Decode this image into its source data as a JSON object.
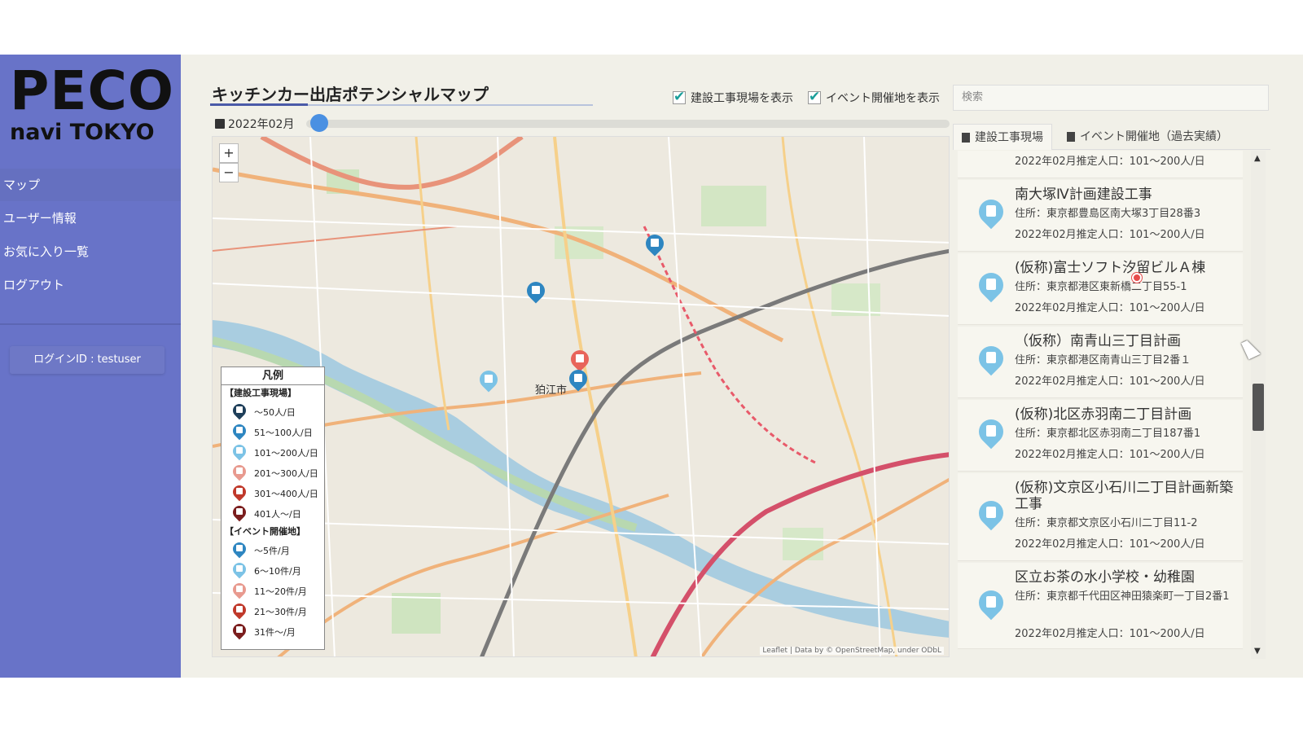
{
  "sidebar": {
    "logo_title": "PECO",
    "logo_sub": "navi TOKYO",
    "items": [
      {
        "label": "マップ"
      },
      {
        "label": "ユーザー情報"
      },
      {
        "label": "お気に入り一覧"
      },
      {
        "label": "ログアウト"
      }
    ],
    "login": "ログインID : testuser"
  },
  "header": {
    "title": "キッチンカー出店ポテンシャルマップ",
    "check_construction": "建設工事現場を表示",
    "check_event": "イベント開催地を表示",
    "search_placeholder": "検索"
  },
  "slider": {
    "date": "2022年02月"
  },
  "map": {
    "zoom_in": "+",
    "zoom_out": "−",
    "attribution": "Leaflet | Data by © OpenStreetMap, under ODbL",
    "town_label": "狛江市"
  },
  "legend": {
    "title": "凡例",
    "construction_heading": "【建設工事現場】",
    "construction": [
      {
        "label": "〜50人/日",
        "color": "#1f3f5a"
      },
      {
        "label": "51〜100人/日",
        "color": "#2e86c1"
      },
      {
        "label": "101〜200人/日",
        "color": "#7cc3e6"
      },
      {
        "label": "201〜300人/日",
        "color": "#e89a8f"
      },
      {
        "label": "301〜400人/日",
        "color": "#c0392b"
      },
      {
        "label": "401人〜/日",
        "color": "#7b1e1e"
      }
    ],
    "event_heading": "【イベント開催地】",
    "event": [
      {
        "label": "〜5件/月",
        "color": "#2e86c1"
      },
      {
        "label": "6〜10件/月",
        "color": "#7cc3e6"
      },
      {
        "label": "11〜20件/月",
        "color": "#e89a8f"
      },
      {
        "label": "21〜30件/月",
        "color": "#c0392b"
      },
      {
        "label": "31件〜/月",
        "color": "#7b1e1e"
      }
    ]
  },
  "tabs": {
    "construction": "建設工事現場",
    "event": "イベント開催地（過去実績）"
  },
  "list": {
    "top_pop": "2022年02月推定人口：101〜200人/日",
    "items": [
      {
        "name": "南大塚Ⅳ計画建設工事",
        "addr": "住所：東京都豊島区南大塚3丁目28番3",
        "pop": "2022年02月推定人口：101〜200人/日"
      },
      {
        "name": "(仮称)富士ソフト汐留ビルＡ棟",
        "addr": "住所：東京都港区東新橋二丁目55-1",
        "pop": "2022年02月推定人口：101〜200人/日"
      },
      {
        "name": "（仮称）南青山三丁目計画",
        "addr": "住所：東京都港区南青山三丁目2番１",
        "pop": "2022年02月推定人口：101〜200人/日"
      },
      {
        "name": "(仮称)北区赤羽南二丁目計画",
        "addr": "住所：東京都北区赤羽南二丁目187番1",
        "pop": "2022年02月推定人口：101〜200人/日"
      },
      {
        "name": "(仮称)文京区小石川二丁目計画新築工事",
        "addr": "住所：東京都文京区小石川二丁目11-2",
        "pop": "2022年02月推定人口：101〜200人/日"
      },
      {
        "name": "区立お茶の水小学校・幼稚園",
        "addr": "住所：東京都千代田区神田猿楽町一丁目2番1",
        "pop": "2022年02月推定人口：101〜200人/日"
      }
    ]
  }
}
